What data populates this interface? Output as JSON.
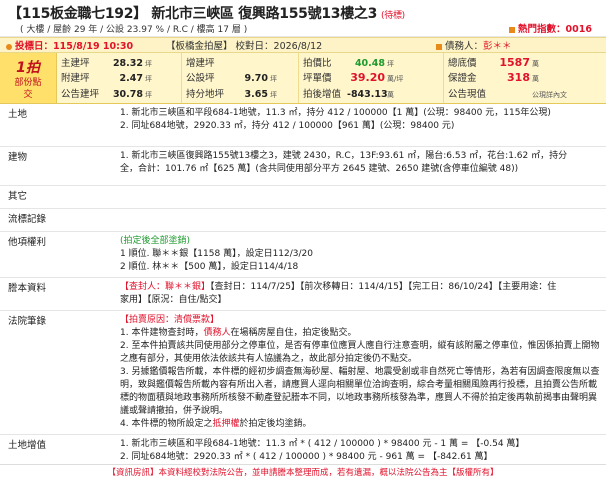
{
  "header": {
    "title": "【115板金職七192】 新北市三峽區 復興路155號13樓之3",
    "pending": "(待標)",
    "sub": "( 大樓 / 屋齡 29 年 / 公設 23.97 % / R.C / 樓高 17 層 )",
    "hot": "熱門指數：0016"
  },
  "bar": {
    "date": "投標日：115/8/19 10:30",
    "court": "【板橋金拍屋】 校對日：2026/8/12",
    "agent_label": "債務人：",
    "agent": "彭＊＊"
  },
  "round": {
    "big": "1拍",
    "line1": "部份點",
    "line2": "交"
  },
  "stats": {
    "c1": [
      {
        "label": "主建坪",
        "value": "28.32",
        "unit": "坪"
      },
      {
        "label": "附建坪",
        "value": "2.47",
        "unit": "坪"
      },
      {
        "label": "公告建坪",
        "value": "30.78",
        "unit": "坪"
      }
    ],
    "c2": [
      {
        "label": "增建坪",
        "value": "",
        "unit": ""
      },
      {
        "label": "公設坪",
        "value": "9.70",
        "unit": "坪"
      },
      {
        "label": "持分地坪",
        "value": "3.65",
        "unit": "坪"
      }
    ],
    "c3": [
      {
        "label": "拍價比",
        "value": "40.48",
        "unit": "坪"
      },
      {
        "label": "坪單價",
        "value": "39.20",
        "unit": "萬/坪"
      },
      {
        "label": "拍後增值",
        "value": "-843.13",
        "unit": "萬"
      }
    ],
    "c4": [
      {
        "label": "總底價",
        "value": "1587",
        "unit": "萬"
      },
      {
        "label": "保證金",
        "value": "318",
        "unit": "萬"
      },
      {
        "label": "公告現值",
        "value": "",
        "unit": "公現詳內文"
      }
    ]
  },
  "rows": {
    "land": {
      "key": "土地",
      "l1": "1. 新北市三峽區和平段684-1地號，11.3 ㎡，持分 412 / 100000【1 萬】(公現：98400 元，115年公現)",
      "l2": "2. 同址684地號，2920.33 ㎡，持分 412 / 100000【961 萬】(公現：98400 元)"
    },
    "building": {
      "key": "建物",
      "l1": "1. 新北市三峽區復興路155號13樓之3，建號 2430，R.C，13F:93.61 ㎡，陽台:6.53 ㎡，花台:1.62 ㎡，持分",
      "l2": "全，合計：101.76 ㎡【625 萬】(含共同使用部分平方 2645 建號、2650 建號(含停車位編號 48))"
    },
    "other": {
      "key": "其它"
    },
    "flow": {
      "key": "流標記錄"
    },
    "rights": {
      "key": "他項權利",
      "l0": "(拍定後全部塗銷)",
      "l1": "1 順位. 聯＊＊銀【1158 萬】，設定日112/3/20",
      "l2": "2 順位. 林＊＊【500 萬】，設定日114/4/18"
    },
    "tenancy": {
      "key": "謄本資料",
      "l1a": "【查封人：聯＊＊銀】",
      "l1b": "【查封日：114/7/25】【前次移轉日：114/4/15】【完工日：86/10/24】【主要用途：住",
      "l2": "家用】【原況：自住/點交】"
    },
    "notes": {
      "key": "法院筆錄",
      "l0": "【拍賣原因：清償票款】",
      "l1a": "1. 本件建物查封時，",
      "l1b": "債務人",
      "l1c": "在場稱房屋自住，拍定後點交。",
      "l2": "2. 至本件拍賣該共同使用部分之停車位，是否有停車位應買人應自行注意查明，縱有該附屬之停車位，惟因係拍賣上開物之應有部分，其使用依法依該共有人協議為之，故此部分拍定後仍不點交。",
      "l3": "3. 另據鑑價報告所載，本件標的經初步調查無海砂屋、輻射屋、地震受創或非自然死亡等情形，為若有因調查限度無以查明，致與鑑價報告所載內容有所出入者，請應買人逕向相關單位洽詢查明，綜合考量相關風險再行投標，且拍賣公告所載標的物面積與地政事務所所核發不動產登記謄本不同，以地政事務所核發為準，應買人不得於拍定後再執前揭事由聲明異議或聲請撤拍，併予說明。",
      "l4a": "4. 本件標的物所設定之",
      "l4b": "抵押權",
      "l4c": "於拍定後均塗銷。"
    },
    "landvalue": {
      "key": "土地增值",
      "l1": "1. 新北市三峽區和平段684-1地號：11.3 ㎡ * ( 412 / 100000 ) * 98400 元 - 1 萬 = 【-0.54 萬】",
      "l2": "2. 同址684地號：2920.33 ㎡ * ( 412 / 100000 ) * 98400 元 - 961 萬 = 【-842.61 萬】"
    }
  },
  "footer": "【資訊房訊】本資料經校對法院公告，並申請謄本整理而成，若有遺漏，概以法院公告為主【版權所有】",
  "colors": {
    "red": "#e1122b",
    "yellow": "#fff6cc",
    "green": "#1f9a2e"
  }
}
